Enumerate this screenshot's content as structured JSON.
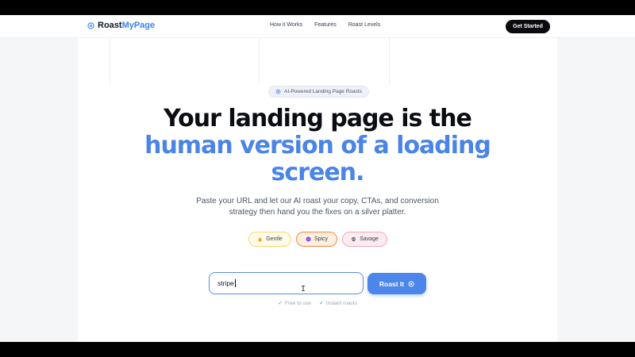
{
  "brand": {
    "name_part1": "Roast",
    "name_part2": "MyPage",
    "icon": "flame-target-icon"
  },
  "nav": {
    "links": [
      "How it Works",
      "Features",
      "Roast Levels"
    ],
    "cta": "Get Started"
  },
  "hero": {
    "badge": "AI-Powered Landing Page Roasts",
    "headline_line1": "Your landing page is the",
    "headline_line2": "human version of a loading",
    "headline_line3": "screen.",
    "subtitle_line1": "Paste your URL and let our AI roast your copy, CTAs, and conversion",
    "subtitle_line2": "strategy then hand you the fixes on a silver platter."
  },
  "levels": [
    {
      "label": "Gentle",
      "icon": "flame-icon"
    },
    {
      "label": "Spicy",
      "icon": "spicy-face-icon"
    },
    {
      "label": "Savage",
      "icon": "skull-icon"
    }
  ],
  "form": {
    "url_value": "stripe",
    "submit_label": "Roast It"
  },
  "perks": [
    "Free to use",
    "Instant roasts"
  ],
  "colors": {
    "accent": "#4a84e6",
    "dark": "#0b0d12",
    "cta_bg": "#0b0b0f",
    "check": "#22c55e"
  }
}
